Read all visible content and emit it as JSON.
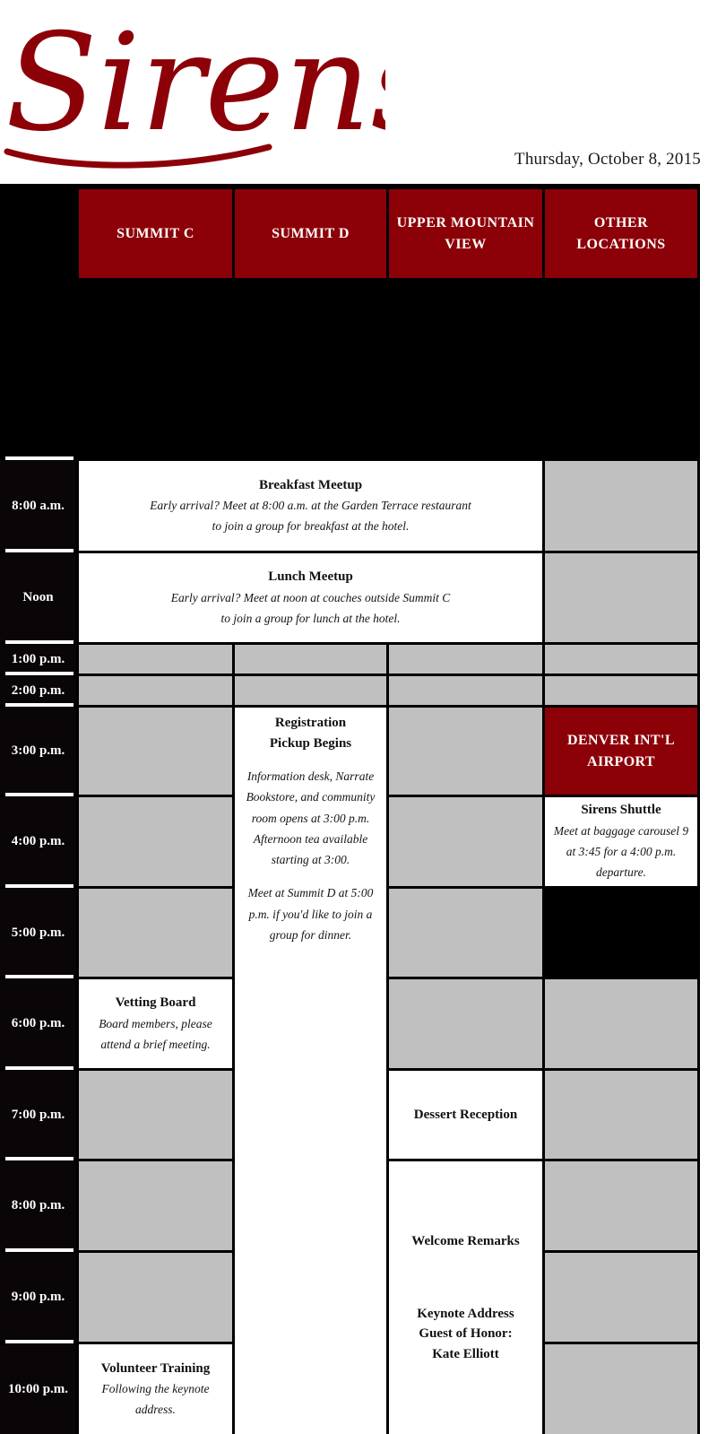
{
  "header": {
    "logo_text": "Sirens",
    "logo_color": "#8c0008",
    "date": "Thursday, October 8, 2015"
  },
  "grid": {
    "colors": {
      "accent_red": "#8c0008",
      "time_column": "#0a0608",
      "empty_cell": "#c0c0c0",
      "event_cell": "#ffffff"
    },
    "corner_label": "",
    "columns": [
      {
        "label": "SUMMIT C"
      },
      {
        "label": "SUMMIT D"
      },
      {
        "label": "UPPER MOUNTAIN VIEW"
      },
      {
        "label": "OTHER LOCATIONS"
      }
    ],
    "times": [
      {
        "label": "8:00 a.m."
      },
      {
        "label": "Noon"
      },
      {
        "label": "1:00 p.m."
      },
      {
        "label": "2:00 p.m."
      },
      {
        "label": "3:00 p.m."
      },
      {
        "label": "4:00 p.m."
      },
      {
        "label": "5:00 p.m."
      },
      {
        "label": "6:00 p.m."
      },
      {
        "label": "7:00 p.m."
      },
      {
        "label": "8:00 p.m."
      },
      {
        "label": "9:00 p.m."
      },
      {
        "label": "10:00 p.m."
      }
    ],
    "events": {
      "breakfast": {
        "title": "Breakfast Meetup",
        "line1": "Early arrival? Meet at 8:00 a.m. at the Garden Terrace restaurant",
        "line2": "to join a group for breakfast at the hotel."
      },
      "lunch": {
        "title": "Lunch Meetup",
        "line1": "Early arrival? Meet at noon at couches outside Summit C",
        "line2": "to join a group for lunch at the hotel."
      },
      "registration": {
        "title_line1": "Registration",
        "title_line2": "Pickup Begins",
        "para1": "Information desk, Narrate Bookstore, and community room opens at 3:00 p.m. Afternoon tea available starting at 3:00.",
        "para2": "Meet at Summit D at 5:00 p.m. if you'd like to join a group for dinner."
      },
      "airport": {
        "title_line1": "DENVER INT'L",
        "title_line2": "AIRPORT"
      },
      "shuttle": {
        "title": "Sirens Shuttle",
        "body": "Meet at baggage carousel 9 at 3:45 for a 4:00 p.m. departure."
      },
      "vetting": {
        "title": "Vetting Board",
        "body": "Board members, please attend a brief meeting."
      },
      "dessert": {
        "title": "Dessert Reception"
      },
      "welcome": {
        "title": "Welcome Remarks"
      },
      "keynote": {
        "line1": "Keynote Address",
        "line2": "Guest of Honor:",
        "line3": "Kate Elliott"
      },
      "volunteer": {
        "title": "Volunteer Training",
        "body": "Following the keynote address."
      }
    }
  }
}
